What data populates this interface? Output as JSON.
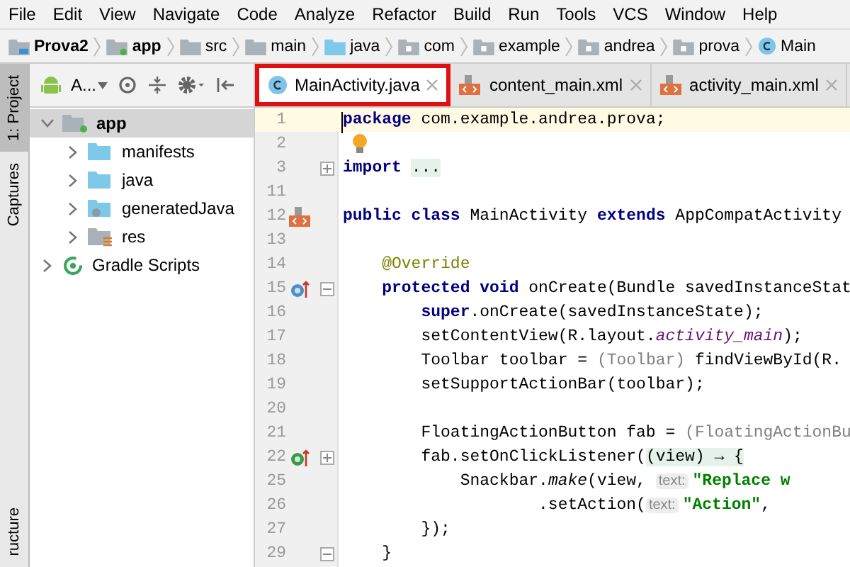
{
  "menu": [
    "File",
    "Edit",
    "View",
    "Navigate",
    "Code",
    "Analyze",
    "Refactor",
    "Build",
    "Run",
    "Tools",
    "VCS",
    "Window",
    "Help"
  ],
  "breadcrumb": [
    {
      "kind": "project",
      "label": "Prova2"
    },
    {
      "kind": "module",
      "label": "app"
    },
    {
      "kind": "folder",
      "label": "src"
    },
    {
      "kind": "folder",
      "label": "main"
    },
    {
      "kind": "source",
      "label": "java"
    },
    {
      "kind": "package",
      "label": "com"
    },
    {
      "kind": "package",
      "label": "example"
    },
    {
      "kind": "package",
      "label": "andrea"
    },
    {
      "kind": "package",
      "label": "prova"
    },
    {
      "kind": "class",
      "label": "Main"
    }
  ],
  "side_stripe": [
    {
      "label": "1: Project",
      "selected": true
    },
    {
      "label": "Captures",
      "selected": false
    },
    {
      "label": "ructure",
      "selected": false
    }
  ],
  "project_toolbar": {
    "view_label": "A..."
  },
  "tree": [
    {
      "kind": "module",
      "label": "app",
      "expanded": true,
      "selected": true,
      "children": [
        {
          "kind": "folder",
          "label": "manifests",
          "expanded": false,
          "selected": false
        },
        {
          "kind": "folder",
          "label": "java",
          "expanded": false,
          "selected": false
        },
        {
          "kind": "generated",
          "label": "generatedJava",
          "expanded": false,
          "selected": false
        },
        {
          "kind": "res",
          "label": "res",
          "expanded": false,
          "selected": false
        }
      ]
    },
    {
      "kind": "gradle",
      "label": "Gradle Scripts",
      "expanded": false,
      "selected": false
    }
  ],
  "tabs": [
    {
      "kind": "class",
      "label": "MainActivity.java",
      "selected": true
    },
    {
      "kind": "xml",
      "label": "content_main.xml",
      "selected": false
    },
    {
      "kind": "xml",
      "label": "activity_main.xml",
      "selected": false
    }
  ],
  "lines": [
    {
      "number": "1",
      "current": true,
      "tokens": [
        {
          "kind": "keyword",
          "text": "package"
        },
        {
          "kind": "plain",
          "text": " com.example.andrea.prova;"
        }
      ]
    },
    {
      "number": "2",
      "current": false,
      "bulb": true
    },
    {
      "number": "3",
      "current": false,
      "fold": {
        "kind": "expand"
      },
      "tokens": [
        {
          "kind": "keyword",
          "text": "import "
        },
        {
          "kind": "folded",
          "text": "..."
        }
      ]
    },
    {
      "number": "11",
      "current": false
    },
    {
      "number": "12",
      "current": false,
      "gutter_icon": {
        "kind": "xml"
      },
      "tokens": [
        {
          "kind": "keyword",
          "text": "public class"
        },
        {
          "kind": "plain",
          "text": " MainActivity "
        },
        {
          "kind": "keyword",
          "text": "extends"
        },
        {
          "kind": "plain",
          "text": " AppCompatActivity"
        }
      ]
    },
    {
      "number": "13",
      "current": false
    },
    {
      "number": "14",
      "current": false,
      "tokens": [
        {
          "kind": "annotation",
          "text": "    @Override"
        }
      ]
    },
    {
      "number": "15",
      "current": false,
      "gutter_icon": {
        "kind": "override"
      },
      "fold": {
        "kind": "collapse"
      },
      "tokens": [
        {
          "kind": "keyword",
          "text": "    protected void"
        },
        {
          "kind": "plain",
          "text": " onCreate(Bundle savedInstanceStat"
        }
      ]
    },
    {
      "number": "16",
      "current": false,
      "tokens": [
        {
          "kind": "keyword",
          "text": "        super"
        },
        {
          "kind": "plain",
          "text": ".onCreate(savedInstanceState);"
        }
      ]
    },
    {
      "number": "17",
      "current": false,
      "tokens": [
        {
          "kind": "plain",
          "text": "        setContentView(R.layout."
        },
        {
          "kind": "field",
          "text": "activity_main"
        },
        {
          "kind": "plain",
          "text": ");"
        }
      ]
    },
    {
      "number": "18",
      "current": false,
      "tokens": [
        {
          "kind": "plain",
          "text": "        Toolbar toolbar = "
        },
        {
          "kind": "gray",
          "text": "(Toolbar)"
        },
        {
          "kind": "plain",
          "text": " findViewById(R."
        }
      ]
    },
    {
      "number": "19",
      "current": false,
      "tokens": [
        {
          "kind": "plain",
          "text": "        setSupportActionBar(toolbar);"
        }
      ]
    },
    {
      "number": "20",
      "current": false
    },
    {
      "number": "21",
      "current": false,
      "tokens": [
        {
          "kind": "plain",
          "text": "        FloatingActionButton fab = "
        },
        {
          "kind": "gray",
          "text": "(FloatingActionBu"
        }
      ]
    },
    {
      "number": "22",
      "current": false,
      "gutter_icon": {
        "kind": "implement"
      },
      "fold": {
        "kind": "expand"
      },
      "tokens": [
        {
          "kind": "plain",
          "text": "        fab.setOnClickListener("
        },
        {
          "kind": "folded",
          "text": "(view) → {"
        }
      ]
    },
    {
      "number": "25",
      "current": false,
      "tokens": [
        {
          "kind": "plain",
          "text": "            Snackbar."
        },
        {
          "kind": "italic",
          "text": "make"
        },
        {
          "kind": "plain",
          "text": "(view, "
        },
        {
          "kind": "hint",
          "text": "text:"
        },
        {
          "kind": "string",
          "text": "\"Replace w"
        }
      ]
    },
    {
      "number": "26",
      "current": false,
      "tokens": [
        {
          "kind": "plain",
          "text": "                    .setAction("
        },
        {
          "kind": "hint",
          "text": "text:"
        },
        {
          "kind": "string",
          "text": "\"Action\""
        },
        {
          "kind": "plain",
          "text": ","
        }
      ]
    },
    {
      "number": "27",
      "current": false,
      "tokens": [
        {
          "kind": "plain",
          "text": "        });"
        }
      ]
    },
    {
      "number": "29",
      "current": false,
      "fold": {
        "kind": "collapse"
      },
      "tokens": [
        {
          "kind": "plain",
          "text": "    }"
        }
      ]
    }
  ]
}
